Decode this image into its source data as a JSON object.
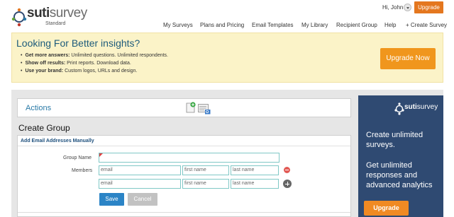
{
  "brand": {
    "name_bold": "suti",
    "name_rest": "survey",
    "edition": "Standard"
  },
  "user": {
    "greeting": "Hi, John",
    "upgrade_label": "Upgrade"
  },
  "nav": {
    "items": [
      {
        "label": "My Surveys"
      },
      {
        "label": "Plans and Pricing"
      },
      {
        "label": "Email Templates"
      },
      {
        "label": "My Library"
      },
      {
        "label": "Recipient Group"
      },
      {
        "label": "Help"
      },
      {
        "label": "+ Create Survey"
      }
    ]
  },
  "banner": {
    "title": "Looking For Better insights?",
    "bullets": [
      {
        "bold": "Get more answers:",
        "text": " Unlimited questions. Unlimited respondents."
      },
      {
        "bold": "Show off results:",
        "text": " Print reports. Download data."
      },
      {
        "bold": "Use your brand:",
        "text": " Custom logos, URLs and design."
      }
    ],
    "button_label": "Upgrade Now"
  },
  "actions": {
    "title": "Actions"
  },
  "create_group": {
    "title": "Create Group",
    "subtitle": "Add Email Addresses Manually",
    "group_name_label": "Group Name",
    "group_name_value": "",
    "members_label": "Members",
    "rows": [
      {
        "email_placeholder": "email",
        "first_placeholder": "first name",
        "last_placeholder": "last name"
      },
      {
        "email_placeholder": "email",
        "first_placeholder": "first name",
        "last_placeholder": "last name"
      }
    ],
    "save_label": "Save",
    "cancel_label": "Cancel"
  },
  "ad": {
    "logo_bold": "suti",
    "logo_rest": "survey",
    "headline": "Create unlimited surveys.",
    "subline": "Get unlimited responses and advanced analytics",
    "button_label": "Upgrade"
  },
  "colors": {
    "accent_orange": "#e4771f",
    "banner_bg": "#fbf3c8",
    "link_blue": "#2a7aa7",
    "save_blue": "#2b84c6",
    "ad_bg": "#2f4a72",
    "field_border": "#80c8c6"
  }
}
